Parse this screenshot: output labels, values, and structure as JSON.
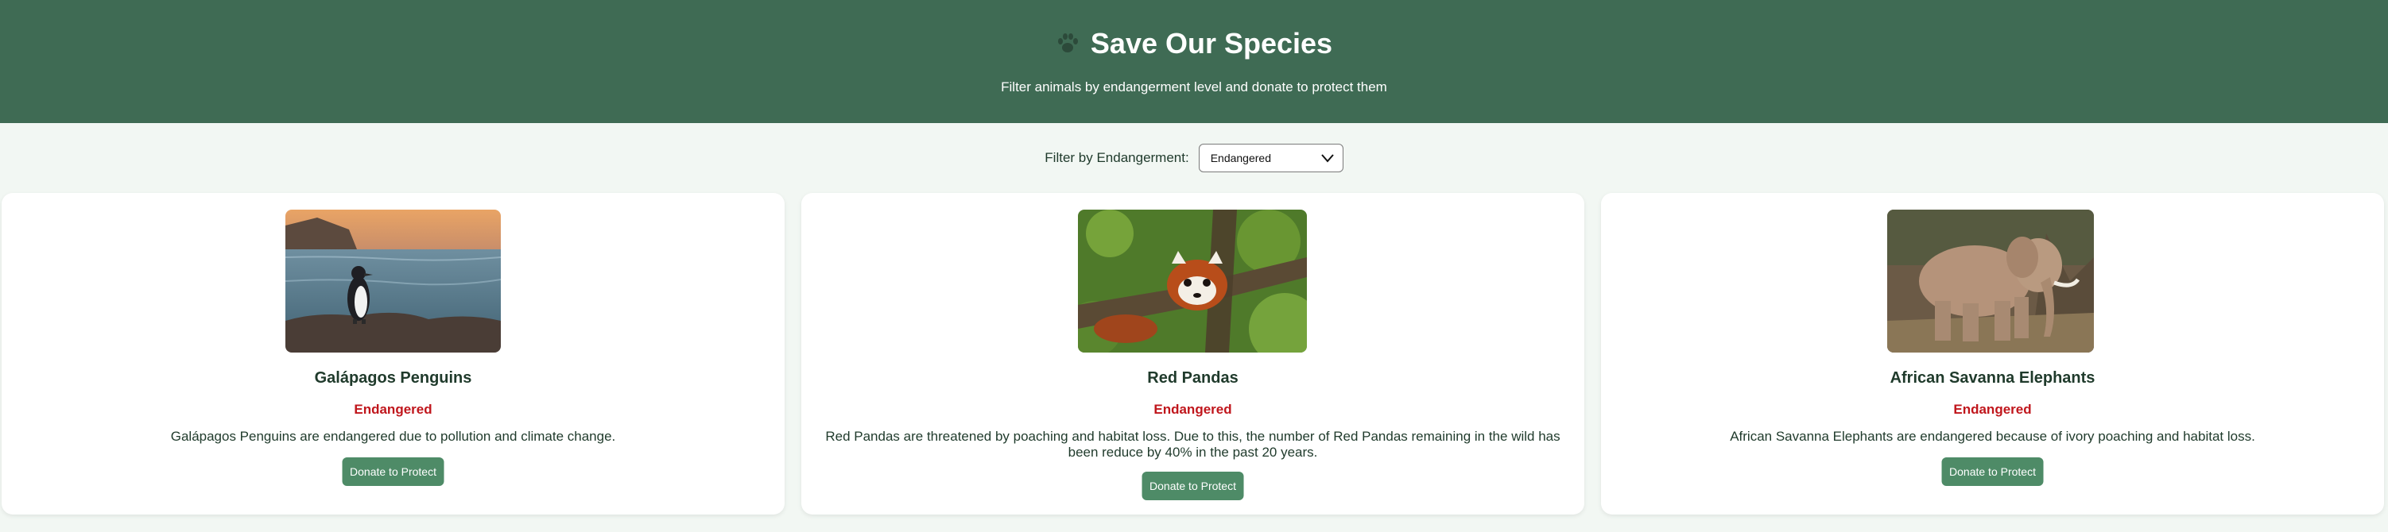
{
  "header": {
    "title": "Save Our Species",
    "icon": "paw-icon",
    "subtitle": "Filter animals by endangerment level and donate to protect them"
  },
  "filter": {
    "label": "Filter by Endangerment:",
    "selected": "Endangered"
  },
  "cards": [
    {
      "name": "Galápagos Penguins",
      "status": "Endangered",
      "description": "Galápagos Penguins are endangered due to pollution and climate change.",
      "button": "Donate to Protect",
      "image": "penguin-photo"
    },
    {
      "name": "Red Pandas",
      "status": "Endangered",
      "description": "Red Pandas are threatened by poaching and habitat loss. Due to this, the number of Red Pandas remaining in the wild has been reduce by 40% in the past 20 years.",
      "button": "Donate to Protect",
      "image": "red-panda-photo"
    },
    {
      "name": "African Savanna Elephants",
      "status": "Endangered",
      "description": "African Savanna Elephants are endangered because of ivory poaching and habitat loss.",
      "button": "Donate to Protect",
      "image": "elephant-photo"
    }
  ],
  "colors": {
    "header_bg": "#3f6b54",
    "page_bg": "#f2f7f3",
    "status": "#c0161c",
    "button_bg": "#4e8b67"
  }
}
